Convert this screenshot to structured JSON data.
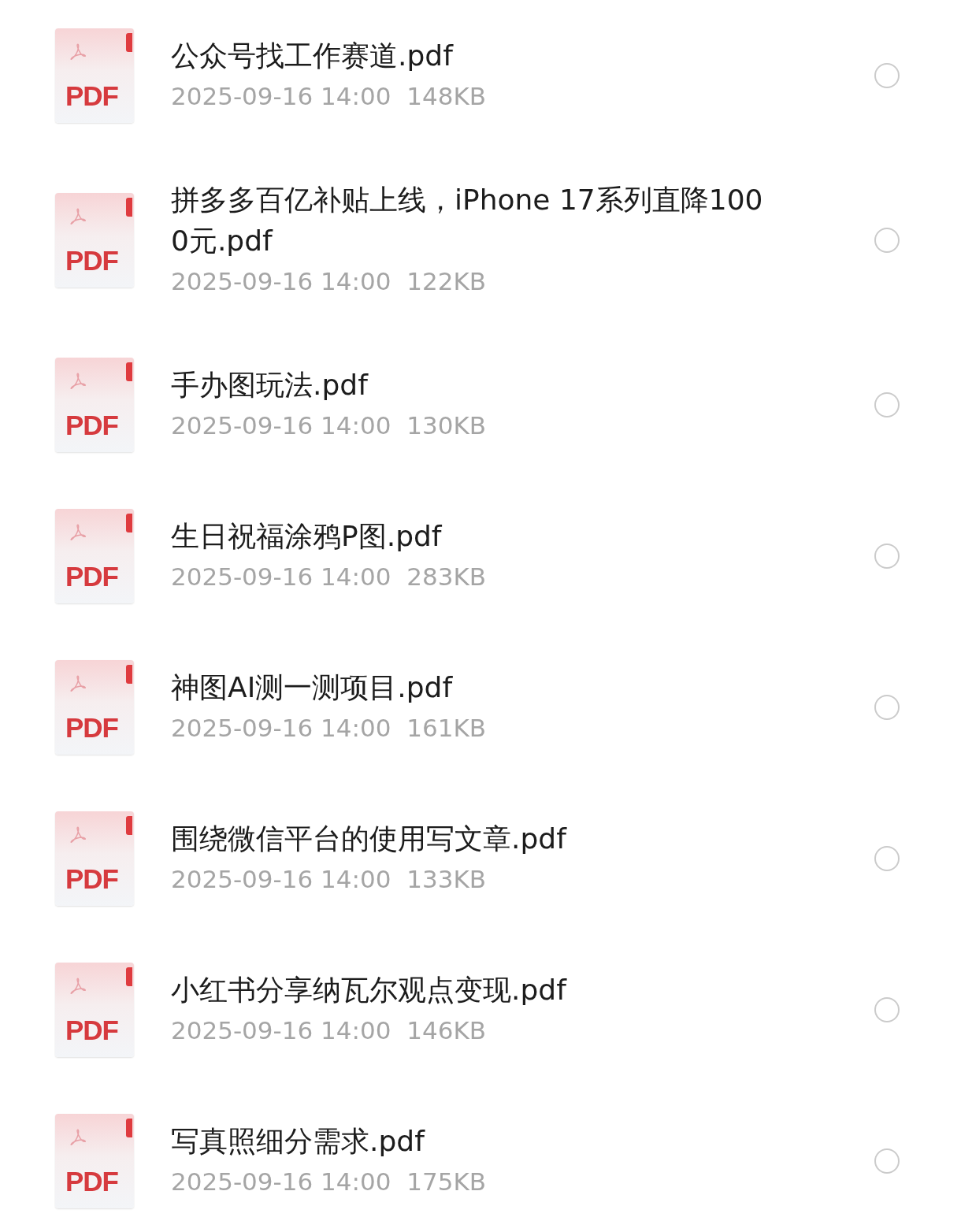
{
  "files": [
    {
      "name": "公众号找工作赛道.pdf",
      "badge": "PDF",
      "date": "2025-09-16 14:00",
      "size": "148KB",
      "selected": false
    },
    {
      "name": "拼多多百亿补贴上线，iPhone 17系列直降1000元.pdf",
      "badge": "PDF",
      "date": "2025-09-16 14:00",
      "size": "122KB",
      "selected": false
    },
    {
      "name": "手办图玩法.pdf",
      "badge": "PDF",
      "date": "2025-09-16 14:00",
      "size": "130KB",
      "selected": false
    },
    {
      "name": "生日祝福涂鸦P图.pdf",
      "badge": "PDF",
      "date": "2025-09-16 14:00",
      "size": "283KB",
      "selected": false
    },
    {
      "name": "神图AI测一测项目.pdf",
      "badge": "PDF",
      "date": "2025-09-16 14:00",
      "size": "161KB",
      "selected": false
    },
    {
      "name": "围绕微信平台的使用写文章.pdf",
      "badge": "PDF",
      "date": "2025-09-16 14:00",
      "size": "133KB",
      "selected": false
    },
    {
      "name": "小红书分享纳瓦尔观点变现.pdf",
      "badge": "PDF",
      "date": "2025-09-16 14:00",
      "size": "146KB",
      "selected": false
    },
    {
      "name": "写真照细分需求.pdf",
      "badge": "PDF",
      "date": "2025-09-16 14:00",
      "size": "175KB",
      "selected": false
    }
  ]
}
